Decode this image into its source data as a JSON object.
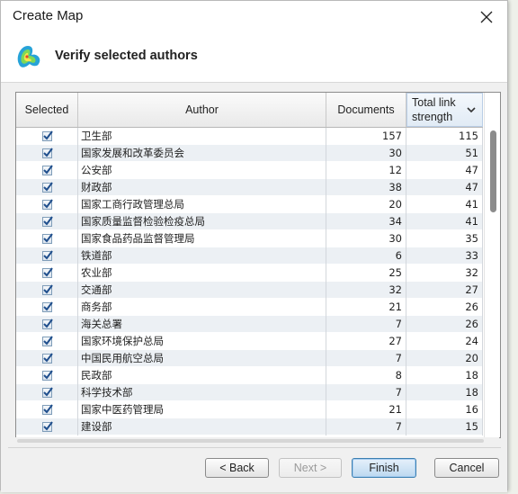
{
  "window": {
    "title": "Create Map"
  },
  "header": {
    "title": "Verify selected authors"
  },
  "table": {
    "columns": {
      "selected": "Selected",
      "author": "Author",
      "documents": "Documents",
      "link_strength_line1": "Total link",
      "link_strength_line2": "strength"
    },
    "sorted_column": "Total link strength",
    "rows": [
      {
        "selected": true,
        "author": "卫生部",
        "documents": "157",
        "link": "115"
      },
      {
        "selected": true,
        "author": "国家发展和改革委员会",
        "documents": "30",
        "link": "51"
      },
      {
        "selected": true,
        "author": "公安部",
        "documents": "12",
        "link": "47"
      },
      {
        "selected": true,
        "author": "财政部",
        "documents": "38",
        "link": "47"
      },
      {
        "selected": true,
        "author": "国家工商行政管理总局",
        "documents": "20",
        "link": "41"
      },
      {
        "selected": true,
        "author": "国家质量监督检验检疫总局",
        "documents": "34",
        "link": "41"
      },
      {
        "selected": true,
        "author": "国家食品药品监督管理局",
        "documents": "30",
        "link": "35"
      },
      {
        "selected": true,
        "author": "铁道部",
        "documents": "6",
        "link": "33"
      },
      {
        "selected": true,
        "author": "农业部",
        "documents": "25",
        "link": "32"
      },
      {
        "selected": true,
        "author": "交通部",
        "documents": "32",
        "link": "27"
      },
      {
        "selected": true,
        "author": "商务部",
        "documents": "21",
        "link": "26"
      },
      {
        "selected": true,
        "author": "海关总署",
        "documents": "7",
        "link": "26"
      },
      {
        "selected": true,
        "author": "国家环境保护总局",
        "documents": "27",
        "link": "24"
      },
      {
        "selected": true,
        "author": "中国民用航空总局",
        "documents": "7",
        "link": "20"
      },
      {
        "selected": true,
        "author": "民政部",
        "documents": "8",
        "link": "18"
      },
      {
        "selected": true,
        "author": "科学技术部",
        "documents": "7",
        "link": "18"
      },
      {
        "selected": true,
        "author": "国家中医药管理局",
        "documents": "21",
        "link": "16"
      },
      {
        "selected": true,
        "author": "建设部",
        "documents": "7",
        "link": "15"
      }
    ]
  },
  "buttons": {
    "back": "< Back",
    "next": "Next >",
    "finish": "Finish",
    "cancel": "Cancel"
  },
  "icons": {
    "close": "close-icon",
    "logo": "vosviewer-logo-icon",
    "sort": "chevron-down-icon",
    "checkbox": "check-icon"
  },
  "colors": {
    "row_alt": "#ecf0f4",
    "primary_button": "#bcd8f0",
    "checkbox_check": "#1f4e8c"
  }
}
